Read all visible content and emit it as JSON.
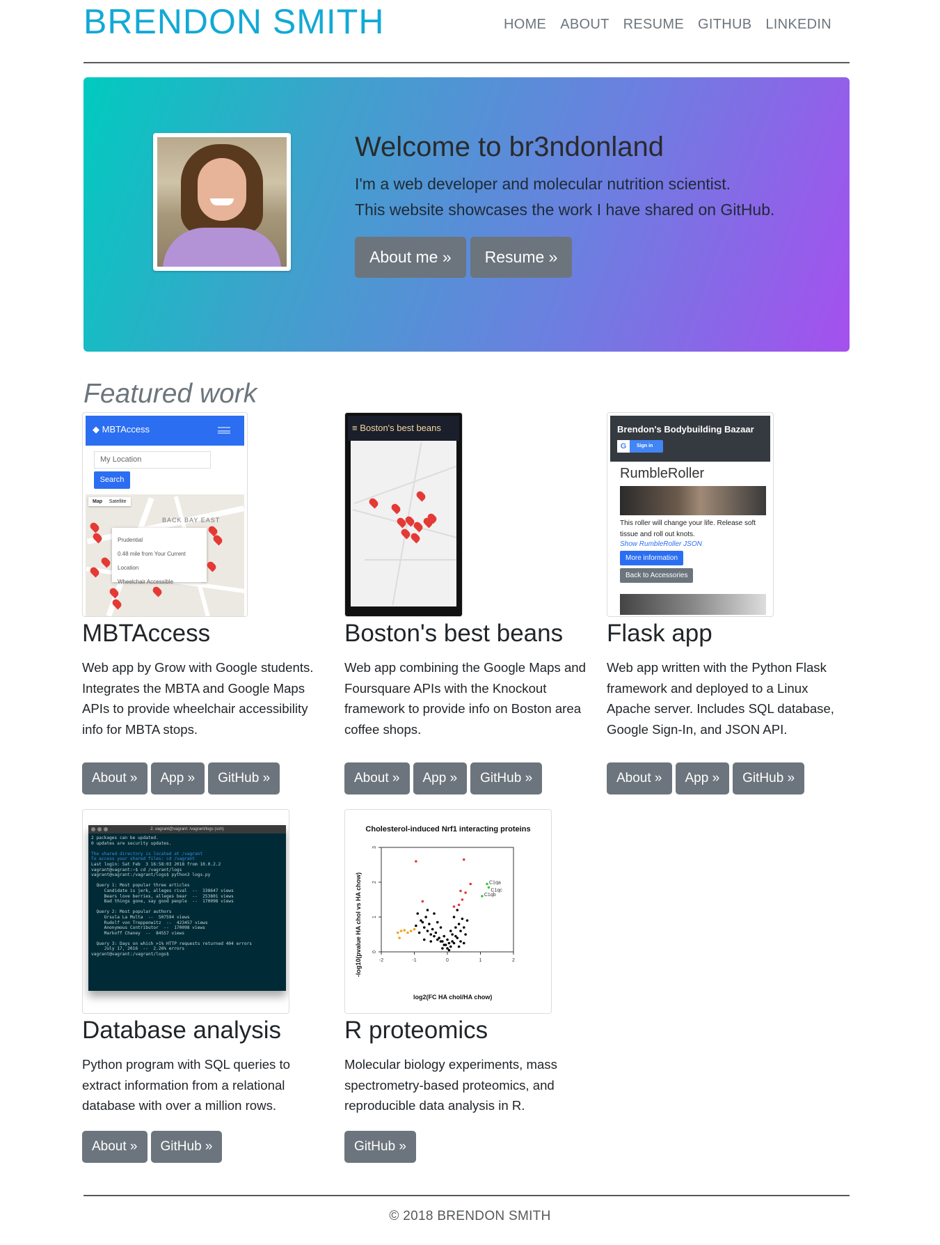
{
  "header": {
    "site_title": "BRENDON SMITH",
    "nav": [
      "HOME",
      "ABOUT",
      "RESUME",
      "GITHUB",
      "LINKEDIN"
    ]
  },
  "hero": {
    "heading": "Welcome to br3ndonland",
    "line1": "I'm a web developer and molecular nutrition scientist.",
    "line2": "This website showcases the work I have shared on GitHub.",
    "about_button": "About me »",
    "resume_button": "Resume »"
  },
  "featured": {
    "heading": "Featured work",
    "projects": [
      {
        "title": "MBTAccess",
        "description": "Web app by Grow with Google students. Integrates the MBTA and Google Maps APIs to provide wheelchair accessibility info for MBTA stops.",
        "buttons": [
          "About »",
          "App »",
          "GitHub »"
        ],
        "thumb": {
          "app_name": "MBTAccess",
          "location_placeholder": "My Location",
          "search": "Search",
          "map_tab": "Map",
          "satellite_tab": "Satellite",
          "area_label": "BACK BAY EAST",
          "popup_title": "Prudential",
          "popup_distance": "0.48 mile from Your Current Location",
          "popup_access": "Wheelchair Accessible"
        }
      },
      {
        "title": "Boston's best beans",
        "description": "Web app combining the Google Maps and Foursquare APIs with the Knockout framework to provide info on Boston area coffee shops.",
        "buttons": [
          "About »",
          "App »",
          "GitHub »"
        ],
        "thumb": {
          "app_name": "Boston's best beans"
        }
      },
      {
        "title": "Flask app",
        "description": "Web app written with the Python Flask framework and deployed to a Linux Apache server. Includes SQL database, Google Sign-In, and JSON API.",
        "buttons": [
          "About »",
          "App »",
          "GitHub »"
        ],
        "thumb": {
          "store_name": "Brendon's Bodybuilding Bazaar",
          "sign_in": "Sign in",
          "product": "RumbleRoller",
          "product_text": "This roller will change your life. Release soft tissue and roll out knots.",
          "json_link": "Show RumbleRoller JSON",
          "more_info": "More information",
          "back": "Back to Accessories"
        }
      },
      {
        "title": "Database analysis",
        "description": "Python program with SQL queries to extract information from a relational database with over a million rows.",
        "buttons": [
          "About »",
          "GitHub »"
        ],
        "thumb": {
          "window_title": "2. vagrant@vagrant: /vagrant/logs (ssh)",
          "terminal_lines": [
            "2 packages can be updated.",
            "0 updates are security updates.",
            "",
            "The shared directory is located at /vagrant",
            "To access your shared files: cd /vagrant",
            "Last login: Sat Feb  3 16:58:03 2018 from 10.0.2.2",
            "vagrant@vagrant:~$ cd /vagrant/logs",
            "vagrant@vagrant:/vagrant/logs$ python3 logs.py",
            "",
            "  Query 1: Most popular three articles",
            "     Candidate is jerk, alleges rival  --  338647 views",
            "     Bears love berries, alleges bear  --  253801 views",
            "     Bad things gone, say good people  --  170098 views",
            "",
            "  Query 2: Most popular authors",
            "     Ursula La Multa  --  507594 views",
            "     Rudolf von Treppenwitz  --  423457 views",
            "     Anonymous Contributor  --  170098 views",
            "     Markoff Chaney  --  84557 views",
            "",
            "  Query 3: Days on which >1% HTTP requests returned 404 errors",
            "     July 17, 2016  --  2.26% errors",
            "vagrant@vagrant:/vagrant/logs$ "
          ]
        }
      },
      {
        "title": "R proteomics",
        "description": "Molecular biology experiments, mass spectrometry-based proteomics, and reproducible data analysis in R.",
        "buttons": [
          "GitHub »"
        ],
        "thumb": {
          "chart_title": "Cholesterol-induced Nrf1 interacting proteins",
          "xlabel": "log2(FC HA chol/HA chow)",
          "ylabel": "-log10(pvalue HA chol vs HA chow)",
          "labels": [
            "C1qa",
            "C1qc",
            "C1qb"
          ]
        }
      }
    ]
  },
  "chart_data": {
    "type": "scatter",
    "title": "Cholesterol-induced Nrf1 interacting proteins",
    "xlabel": "log2(FC HA chol/HA chow)",
    "ylabel": "-log10(pvalue HA chol vs HA chow)",
    "xlim": [
      -2,
      2
    ],
    "ylim": [
      0,
      3
    ],
    "x_ticks": [
      "-2",
      "-1",
      "0",
      "1",
      "2"
    ],
    "y_ticks": [
      "0",
      "1",
      "2",
      "3"
    ],
    "series": [
      {
        "color": "#000000",
        "points": [
          [
            -0.9,
            1.1
          ],
          [
            -0.8,
            0.9
          ],
          [
            -0.7,
            0.7
          ],
          [
            -0.6,
            0.6
          ],
          [
            -0.5,
            0.5
          ],
          [
            -0.4,
            0.45
          ],
          [
            -0.3,
            0.35
          ],
          [
            -0.2,
            0.3
          ],
          [
            -0.1,
            0.2
          ],
          [
            0,
            0.1
          ],
          [
            0.1,
            0.15
          ],
          [
            0.2,
            0.25
          ],
          [
            0.3,
            0.4
          ],
          [
            0.4,
            0.6
          ],
          [
            0.5,
            0.7
          ],
          [
            -0.85,
            0.55
          ],
          [
            -0.75,
            0.85
          ],
          [
            -0.65,
            1.0
          ],
          [
            -0.55,
            0.8
          ],
          [
            -0.45,
            0.65
          ],
          [
            -0.35,
            0.55
          ],
          [
            -0.25,
            0.4
          ],
          [
            -0.15,
            0.3
          ],
          [
            -0.05,
            0.2
          ],
          [
            0.05,
            0.05
          ],
          [
            0.15,
            0.3
          ],
          [
            0.25,
            0.45
          ],
          [
            0.35,
            0.8
          ],
          [
            0.45,
            0.95
          ],
          [
            0.55,
            0.5
          ],
          [
            -0.6,
            1.2
          ],
          [
            -0.4,
            1.1
          ],
          [
            0.2,
            1.0
          ],
          [
            0.3,
            1.2
          ],
          [
            0.1,
            0.6
          ],
          [
            -0.2,
            0.7
          ],
          [
            -0.1,
            0.45
          ],
          [
            0.0,
            0.35
          ],
          [
            0.15,
            0.5
          ],
          [
            -0.3,
            0.85
          ],
          [
            -0.5,
            0.3
          ],
          [
            0.4,
            0.3
          ],
          [
            0.5,
            0.25
          ],
          [
            -0.7,
            0.35
          ],
          [
            0.6,
            0.9
          ],
          [
            -0.95,
            0.75
          ],
          [
            0.35,
            0.15
          ],
          [
            -0.15,
            0.1
          ],
          [
            0.05,
            0.25
          ],
          [
            0.25,
            0.7
          ]
        ]
      },
      {
        "color": "#e53935",
        "points": [
          [
            -0.95,
            2.6
          ],
          [
            0.5,
            2.65
          ],
          [
            0.7,
            1.95
          ],
          [
            0.45,
            1.5
          ],
          [
            0.35,
            1.35
          ],
          [
            0.55,
            1.7
          ],
          [
            -0.75,
            1.45
          ],
          [
            0.2,
            1.3
          ],
          [
            0.4,
            1.75
          ]
        ]
      },
      {
        "color": "#f0a020",
        "points": [
          [
            -1.5,
            0.55
          ],
          [
            -1.4,
            0.6
          ],
          [
            -1.3,
            0.62
          ],
          [
            -1.2,
            0.55
          ],
          [
            -1.45,
            0.4
          ],
          [
            -1.0,
            0.65
          ],
          [
            -1.1,
            0.6
          ]
        ]
      },
      {
        "color": "#2ecc40",
        "points": [
          [
            1.2,
            1.95
          ],
          [
            1.25,
            1.85
          ],
          [
            1.05,
            1.6
          ]
        ]
      }
    ]
  },
  "footer": {
    "text": "© 2018 BRENDON SMITH"
  }
}
